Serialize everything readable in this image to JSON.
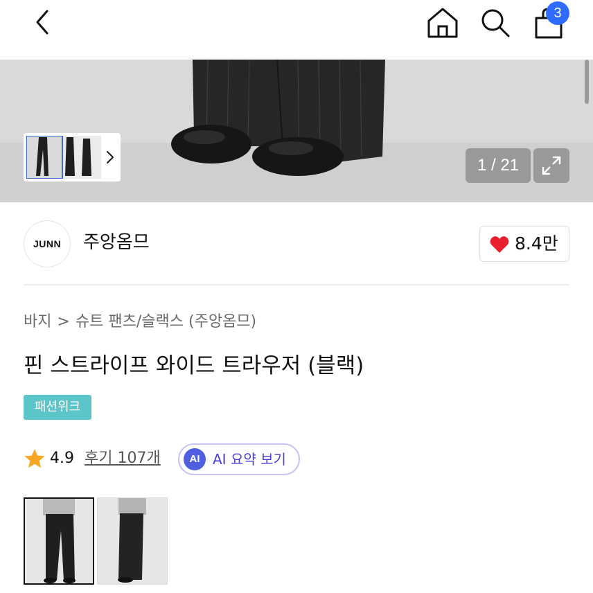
{
  "header": {
    "back_icon": "chevron-left-icon",
    "home_icon": "home-icon",
    "search_icon": "search-icon",
    "bag_icon": "shopping-bag-icon",
    "cart_count": "3",
    "badge_color": "#2f6bff"
  },
  "gallery": {
    "counter": "1 / 21",
    "expand_icon": "expand-icon",
    "thumb_arrow_icon": "chevron-right-icon"
  },
  "brand": {
    "logo_text": "JUNN",
    "name": "주앙옴므",
    "like_icon": "heart-icon",
    "like_color": "#e8202e",
    "like_count": "8.4만"
  },
  "breadcrumb": {
    "category": "바지",
    "separator": ">",
    "subcategory": "슈트 팬츠/슬랙스 (주앙옴므)"
  },
  "product": {
    "title": "핀 스트라이프 와이드 트라우저 (블랙)",
    "tag": "패션위크",
    "tag_color": "#5bc5ca"
  },
  "rating": {
    "star_icon": "star-icon",
    "score": "4.9",
    "reviews": "후기 107개",
    "ai_badge": "AI",
    "ai_label": "AI 요약 보기"
  },
  "variants": [
    {
      "name": "variant-front",
      "selected": true
    },
    {
      "name": "variant-side",
      "selected": false
    }
  ]
}
